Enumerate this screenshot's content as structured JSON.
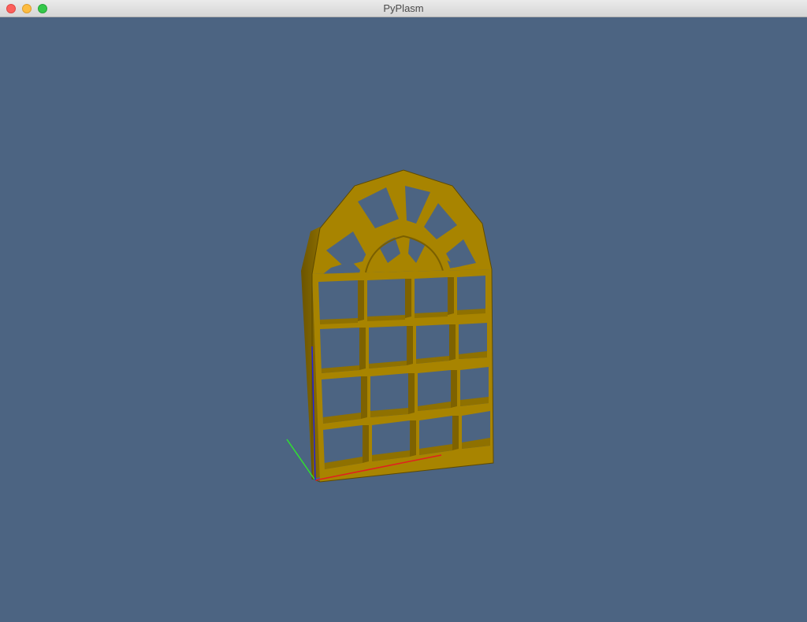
{
  "window": {
    "title": "PyPlasm"
  },
  "scene": {
    "background_color": "#4c6482",
    "model_color": "#a88400",
    "model_shadow_color": "#7a5f00",
    "axis_colors": {
      "x": "#e02020",
      "y": "#30e030",
      "z": "#2020e0"
    }
  }
}
